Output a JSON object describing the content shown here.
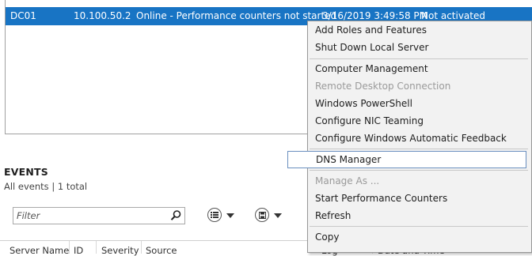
{
  "server_row": {
    "name": "DC01",
    "ip": "10.100.50.2",
    "status": "Online - Performance counters not started",
    "date": "3/16/2019 3:49:58 PM",
    "activation": "Not activated"
  },
  "events": {
    "title": "EVENTS",
    "subtitle": "All events | 1 total"
  },
  "filter": {
    "placeholder": "Filter",
    "search_icon": "search-icon"
  },
  "toolbar": {
    "list_icon": "list-options-icon",
    "save_icon": "save-icon"
  },
  "columns": [
    {
      "label": "Server Name"
    },
    {
      "label": "ID"
    },
    {
      "label": "Severity"
    },
    {
      "label": "Source"
    },
    {
      "label": "Log"
    },
    {
      "label": "Date and Time"
    }
  ],
  "context_menu": {
    "items": [
      {
        "label": "Add Roles and Features",
        "disabled": false
      },
      {
        "label": "Shut Down Local Server",
        "disabled": false
      },
      {
        "label": "Computer Management",
        "disabled": false
      },
      {
        "label": "Remote Desktop Connection",
        "disabled": true
      },
      {
        "label": "Windows PowerShell",
        "disabled": false
      },
      {
        "label": "Configure NIC Teaming",
        "disabled": false
      },
      {
        "label": "Configure Windows Automatic Feedback",
        "disabled": false
      },
      {
        "label": "DNS Manager",
        "disabled": false,
        "highlighted": true
      },
      {
        "label": "Manage As ...",
        "disabled": true
      },
      {
        "label": "Start Performance Counters",
        "disabled": false
      },
      {
        "label": "Refresh",
        "disabled": false
      },
      {
        "label": "Copy",
        "disabled": false
      }
    ]
  },
  "colors": {
    "selection": "#1874c4",
    "menu_bg": "#f2f2f2",
    "highlight_border": "#6a8fbf"
  }
}
